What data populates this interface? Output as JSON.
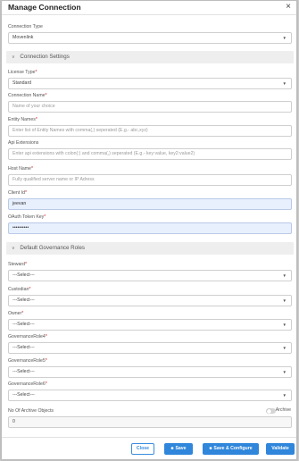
{
  "dialog": {
    "title": "Manage Connection",
    "close_glyph": "×"
  },
  "connection_type": {
    "label": "Connection Type",
    "value": "Movenlink"
  },
  "sections": {
    "connection_settings": "Connection Settings",
    "governance_roles": "Default Governance Roles"
  },
  "license_type": {
    "label": "License Type",
    "value": "Standard"
  },
  "connection_name": {
    "label": "Connection Name",
    "placeholder": "Name of your choice"
  },
  "entity_names": {
    "label": "Entity Names",
    "placeholder": "Enter list of Entity Names with comma(,) seperated (E.g.- abc,xyz)"
  },
  "api_extensions": {
    "label": "Api Extensions",
    "placeholder": "Enter api extensions with colon(:) and comma(,) seperated (E.g.- key:value, key2:value2)"
  },
  "host_name": {
    "label": "Host Name",
    "placeholder": "Fully qualified server name or IP Adress"
  },
  "client_id": {
    "label": "Client Id",
    "value": "jeevan"
  },
  "oauth_token_key": {
    "label": "OAuth Token Key",
    "value": "••••••••••"
  },
  "roles": [
    {
      "label": "Steward",
      "value": "---Select---",
      "required": true
    },
    {
      "label": "Custodian",
      "value": "---Select---",
      "required": true
    },
    {
      "label": "Owner",
      "value": "---Select---",
      "required": true
    },
    {
      "label": "GovernanceRole4",
      "value": "---Select---",
      "required": true
    },
    {
      "label": "GovernanceRole5",
      "value": "---Select---",
      "required": true
    },
    {
      "label": "GovernanceRole6",
      "value": "---Select---",
      "required": true
    }
  ],
  "archive": {
    "label": "No Of Archive Objects",
    "value": "0",
    "toggle_label": "Archive",
    "toggle_on": false
  },
  "buttons": {
    "close": "Close",
    "save": "Save",
    "save_configure": "Save & Configure",
    "validate": "Validate"
  },
  "required_mark": "*",
  "select_caret": "▼",
  "section_chevron": "∨",
  "colors": {
    "primary": "#2f86db",
    "required": "#d42020",
    "autofill": "#e8f0fe",
    "section": "#eeeeee"
  }
}
